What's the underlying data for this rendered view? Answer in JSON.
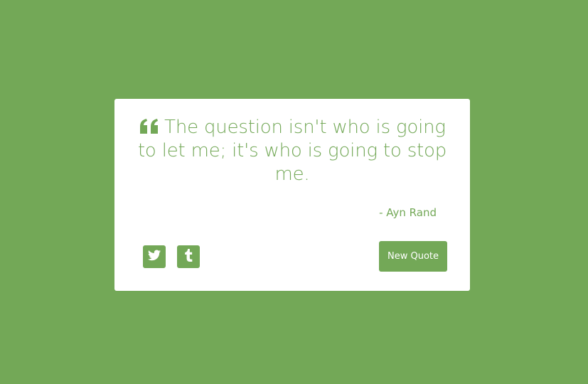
{
  "quote": {
    "text": "The question isn't who is going to let me; it's who is going to stop me.",
    "author": "- Ayn Rand",
    "quote_icon": "quote-left-icon"
  },
  "actions": {
    "twitter_icon": "twitter-icon",
    "tumblr_icon": "tumblr-icon",
    "new_quote_label": "New Quote"
  },
  "colors": {
    "accent": "#73a857",
    "card": "#ffffff"
  }
}
